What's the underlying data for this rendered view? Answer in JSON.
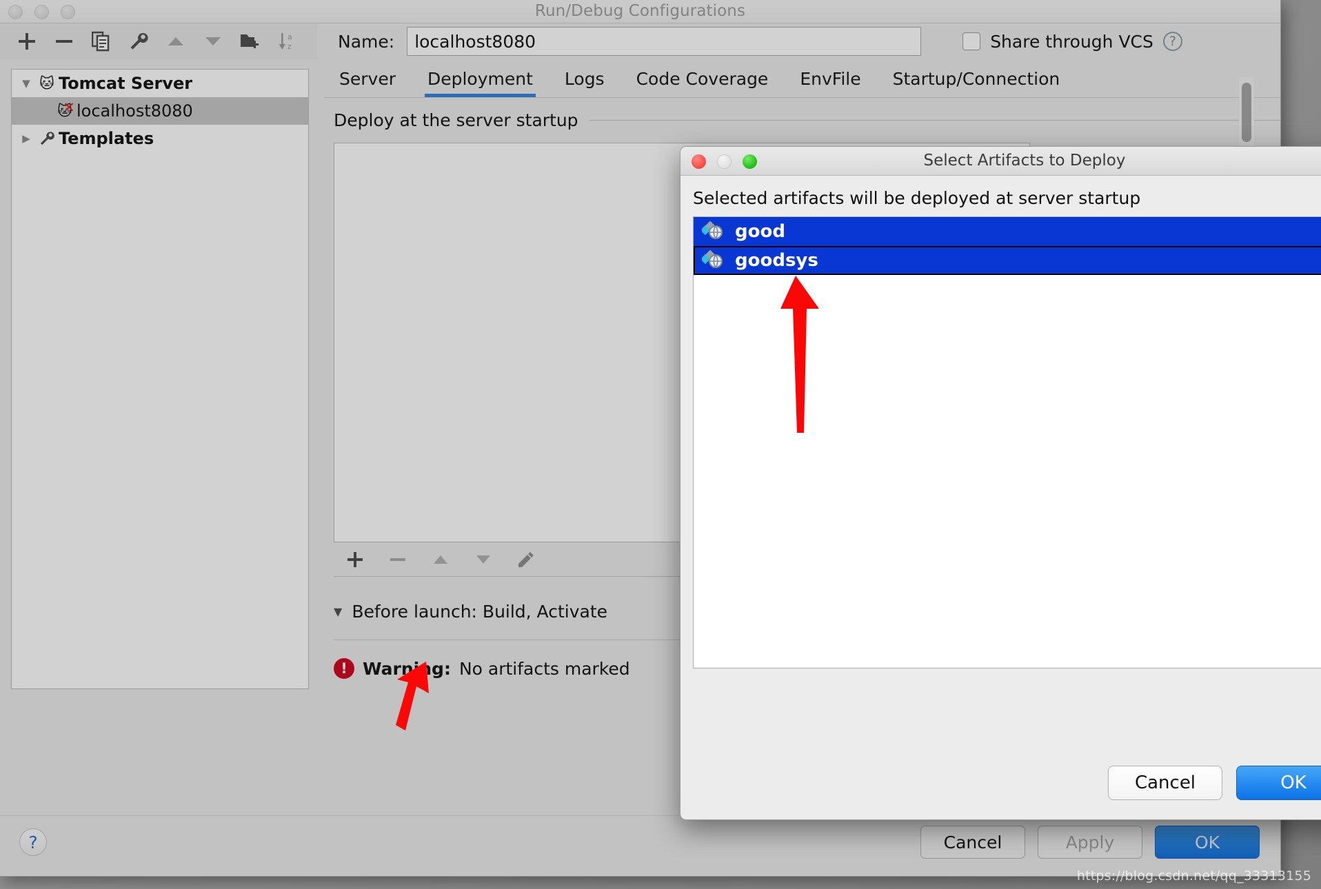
{
  "window": {
    "title": "Run/Debug Configurations",
    "traffic_lights": [
      "close",
      "minimize",
      "zoom"
    ]
  },
  "toolbar": {
    "buttons": [
      {
        "name": "add",
        "icon": "plus-icon"
      },
      {
        "name": "remove",
        "icon": "minus-icon"
      },
      {
        "name": "copy",
        "icon": "copy-icon"
      },
      {
        "name": "edit-templates",
        "icon": "wrench-icon"
      },
      {
        "name": "move-up",
        "icon": "triangle-up-icon"
      },
      {
        "name": "move-down",
        "icon": "triangle-down-icon"
      },
      {
        "name": "new-folder",
        "icon": "folder-add-icon"
      },
      {
        "name": "sort-alphabetically",
        "icon": "sort-az-icon"
      }
    ]
  },
  "tree": {
    "nodes": [
      {
        "label": "Tomcat Server",
        "icon": "tomcat-icon",
        "twisty": "▼",
        "bold": true,
        "selected": false,
        "indent": 0
      },
      {
        "label": "localhost8080",
        "icon": "tomcat-error-icon",
        "twisty": "",
        "bold": false,
        "selected": true,
        "indent": 1
      },
      {
        "label": "Templates",
        "icon": "wrench-icon",
        "twisty": "▶",
        "bold": true,
        "selected": false,
        "indent": 0
      }
    ]
  },
  "form": {
    "name_label": "Name:",
    "name_value": "localhost8080",
    "name_placeholder": "Name",
    "share_vcs_label": "Share through VCS",
    "share_vcs_checked": false,
    "help_glyph": "?"
  },
  "tabs": {
    "items": [
      {
        "label": "Server",
        "active": false
      },
      {
        "label": "Deployment",
        "active": true
      },
      {
        "label": "Logs",
        "active": false
      },
      {
        "label": "Code Coverage",
        "active": false
      },
      {
        "label": "EnvFile",
        "active": false
      },
      {
        "label": "Startup/Connection",
        "active": false
      }
    ]
  },
  "deployment": {
    "section_title": "Deploy at the server startup",
    "list_items": [],
    "tools": [
      {
        "name": "add-artifact",
        "icon": "plus-icon"
      },
      {
        "name": "remove-artifact",
        "icon": "minus-icon"
      },
      {
        "name": "move-artifact-up",
        "icon": "triangle-up-icon"
      },
      {
        "name": "move-artifact-down",
        "icon": "triangle-down-icon"
      },
      {
        "name": "edit-artifact",
        "icon": "pencil-icon"
      }
    ],
    "before_launch": "Before launch: Build, Activate",
    "before_launch_twisty": "▼",
    "warning_label": "Warning:",
    "warning_text": "No artifacts marked"
  },
  "bottom_bar": {
    "help_glyph": "?",
    "buttons": [
      {
        "label": "Cancel",
        "style": "default",
        "disabled": false
      },
      {
        "label": "Apply",
        "style": "default",
        "disabled": true
      },
      {
        "label": "OK",
        "style": "primary",
        "disabled": false
      }
    ]
  },
  "dialog": {
    "title": "Select Artifacts to Deploy",
    "caption": "Selected artifacts will be deployed at server startup",
    "artifacts": [
      {
        "label": "good",
        "icon": "artifact-icon",
        "selected": true,
        "focused": false
      },
      {
        "label": "goodsys",
        "icon": "artifact-icon",
        "selected": true,
        "focused": true
      }
    ],
    "buttons": [
      {
        "label": "Cancel",
        "style": "default"
      },
      {
        "label": "OK",
        "style": "primary"
      }
    ]
  },
  "annotations": {
    "arrow_color": "#fb0707",
    "arrows": [
      {
        "name": "arrow-to-artifact-list",
        "points_at": "goodsys"
      },
      {
        "name": "arrow-to-add-artifact",
        "points_at": "add-artifact"
      }
    ]
  },
  "watermark": {
    "text": "https://blog.csdn.net/qq_33313155"
  },
  "colors": {
    "selection_blue": "#0837d4",
    "tab_accent": "#2f7fe0",
    "primary_button": "#0f6fe0",
    "warning_red": "#d0021b",
    "arrow_red": "#fb0707"
  }
}
